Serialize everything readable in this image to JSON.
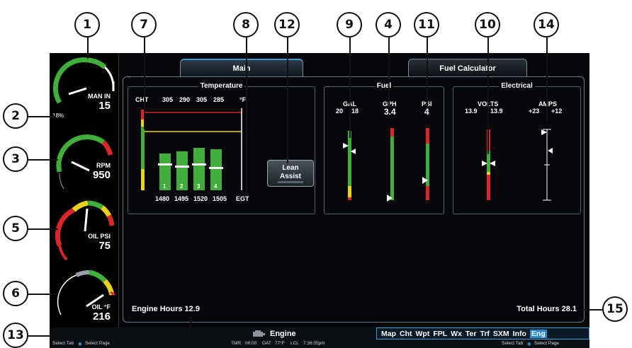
{
  "callouts": [
    "1",
    "2",
    "3",
    "4",
    "5",
    "6",
    "7",
    "8",
    "9",
    "10",
    "11",
    "12",
    "13",
    "14",
    "15"
  ],
  "gauges": {
    "man_in": {
      "label": "MAN IN",
      "value": "15",
      "percent": "18%"
    },
    "rpm": {
      "label": "RPM",
      "value": "950"
    },
    "oil_psi": {
      "label": "OIL PSI",
      "value": "75"
    },
    "oil_f": {
      "label": "OIL °F",
      "value": "216"
    }
  },
  "tabs": {
    "main": "Main",
    "fuel_calc": "Fuel Calculator"
  },
  "temperature": {
    "title": "Temperature",
    "cht_label": "CHT",
    "cht_values": [
      "305",
      "290",
      "305",
      "285"
    ],
    "unit": "°F",
    "cylinders": [
      "1",
      "2",
      "3",
      "4"
    ],
    "egt_values": [
      "1480",
      "1495",
      "1520",
      "1505"
    ],
    "egt_label": "EGT"
  },
  "lean_assist": {
    "line1": "Lean",
    "line2": "Assist"
  },
  "fuel": {
    "title": "Fuel",
    "gal_label": "GAL",
    "gal_left": "20",
    "gal_right": "18",
    "gph_label": "GPH",
    "gph_value": "3.4",
    "psi_label": "PSI",
    "psi_value": "4"
  },
  "electrical": {
    "title": "Electrical",
    "volts_label": "VOLTS",
    "volts_1": "13.9",
    "volts_2": "13.9",
    "amps_label": "AMPS",
    "amps_1": "+23",
    "amps_2": "+12"
  },
  "hours": {
    "engine": "Engine Hours 12.9",
    "total": "Total Hours 28.1"
  },
  "bottom": {
    "page_title": "Engine",
    "nav": [
      "Map",
      "Cht",
      "Wpt",
      "FPL",
      "Wx",
      "Ter",
      "Trf",
      "SXM",
      "Info",
      "Eng"
    ],
    "status_left": "Select Tab",
    "status_left2": "Select Page",
    "tmr": "TMR",
    "tmr_value": "00:00",
    "oat": "OAT",
    "oat_value": "77°F",
    "lcl": "LCL",
    "lcl_value": "7:38:05pm",
    "status_right": "Select Tab",
    "status_right2": "Select Page"
  },
  "colors": {
    "green": "#3fae3a",
    "red": "#d8262a",
    "yellow": "#e8d21c",
    "accent": "#2b8ad0"
  }
}
